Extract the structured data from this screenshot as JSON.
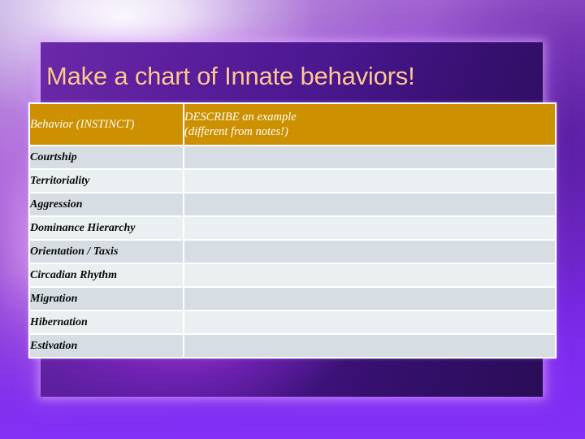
{
  "slide": {
    "title": "Make a chart of Innate behaviors!",
    "title_color": "#fcc793",
    "panel_color": "#49178e",
    "background_color": "#7b2ae8"
  },
  "table": {
    "header_background": "#cc9000",
    "header_text_color": "#ffffff",
    "row_color_a": "#d7dee3",
    "row_color_b": "#eaeff2",
    "columns": [
      {
        "key": "behavior",
        "label": "Behavior (INSTINCT)"
      },
      {
        "key": "describe",
        "label_line1": "DESCRIBE an example",
        "label_line2": "(different from notes!)"
      }
    ],
    "rows": [
      {
        "behavior": "Courtship",
        "describe": ""
      },
      {
        "behavior": "Territoriality",
        "describe": ""
      },
      {
        "behavior": "Aggression",
        "describe": ""
      },
      {
        "behavior": "Dominance Hierarchy",
        "describe": ""
      },
      {
        "behavior": "Orientation / Taxis",
        "describe": ""
      },
      {
        "behavior": "Circadian Rhythm",
        "describe": ""
      },
      {
        "behavior": "Migration",
        "describe": ""
      },
      {
        "behavior": "Hibernation",
        "describe": ""
      },
      {
        "behavior": "Estivation",
        "describe": ""
      }
    ]
  }
}
